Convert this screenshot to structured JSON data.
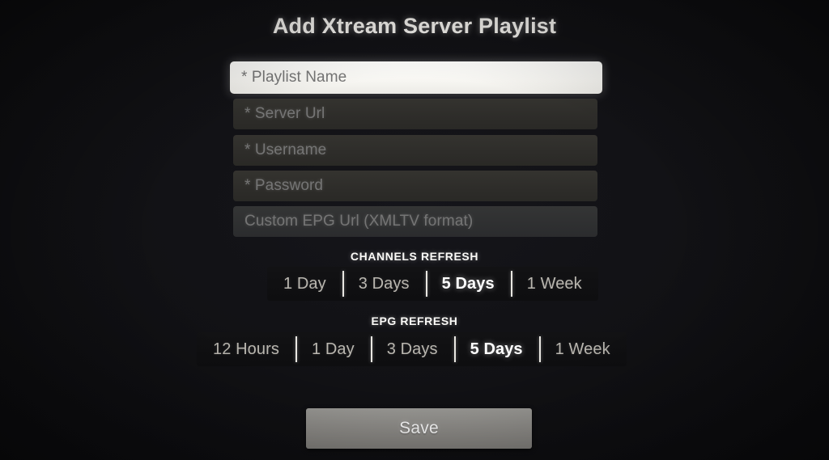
{
  "screen": {
    "title": "Add Xtream Server Playlist",
    "background_color": "#101013",
    "accent_color": "#ffffff"
  },
  "form": {
    "fields": [
      {
        "name": "playlist-name",
        "placeholder": "* Playlist Name",
        "value": "",
        "required": true,
        "focused": true
      },
      {
        "name": "server-url",
        "placeholder": "* Server Url",
        "value": "",
        "required": true,
        "focused": false
      },
      {
        "name": "username",
        "placeholder": "* Username",
        "value": "",
        "required": true,
        "focused": false
      },
      {
        "name": "password",
        "placeholder": "* Password",
        "value": "",
        "required": true,
        "focused": false
      },
      {
        "name": "custom-epg-url",
        "placeholder": "Custom EPG Url (XMLTV format)",
        "value": "",
        "required": false,
        "focused": false
      }
    ]
  },
  "channels_refresh": {
    "header": "CHANNELS REFRESH",
    "selected": "5 Days",
    "options": [
      {
        "label": "1 Day",
        "selected": false
      },
      {
        "label": "3 Days",
        "selected": false
      },
      {
        "label": "5 Days",
        "selected": true
      },
      {
        "label": "1 Week",
        "selected": false
      }
    ]
  },
  "epg_refresh": {
    "header": "EPG REFRESH",
    "selected": "5 Days",
    "options": [
      {
        "label": "12 Hours",
        "selected": false
      },
      {
        "label": "1 Day",
        "selected": false
      },
      {
        "label": "3 Days",
        "selected": false
      },
      {
        "label": "5 Days",
        "selected": true
      },
      {
        "label": "1 Week",
        "selected": false
      }
    ]
  },
  "actions": {
    "save_label": "Save"
  }
}
